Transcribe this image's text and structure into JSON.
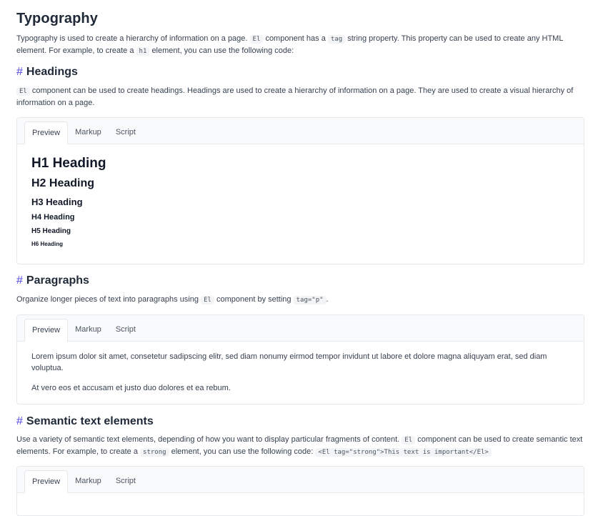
{
  "title": "Typography",
  "intro": {
    "t1": "Typography is used to create a hierarchy of information on a page.",
    "c1": "El",
    "t2": "component has a",
    "c2": "tag",
    "t3": "string property. This property can be used to create any HTML element. For example, to create a",
    "c3": "h1",
    "t4": "element, you can use the following code:"
  },
  "headings": {
    "hash": "#",
    "title": "Headings",
    "c1": "El",
    "text": "component can be used to create headings. Headings are used to create a hierarchy of information on a page. They are used to create a visual hierarchy of information on a page.",
    "tabs": [
      "Preview",
      "Markup",
      "Script"
    ],
    "preview": [
      "H1 Heading",
      "H2 Heading",
      "H3 Heading",
      "H4 Heading",
      "H5 Heading",
      "H6 Heading"
    ]
  },
  "paragraphs": {
    "hash": "#",
    "title": "Paragraphs",
    "t1": "Organize longer pieces of text into paragraphs using",
    "c1": "El",
    "t2": "component by setting",
    "c2": "tag=\"p\"",
    "t3": ".",
    "tabs": [
      "Preview",
      "Markup",
      "Script"
    ],
    "preview": [
      "Lorem ipsum dolor sit amet, consetetur sadipscing elitr, sed diam nonumy eirmod tempor invidunt ut labore et dolore magna aliquyam erat, sed diam voluptua.",
      "At vero eos et accusam et justo duo dolores et ea rebum."
    ]
  },
  "semantic": {
    "hash": "#",
    "title": "Semantic text elements",
    "t1": "Use a variety of semantic text elements, depending of how you want to display particular fragments of content.",
    "c1": "El",
    "t2": "component can be used to create semantic text elements. For example, to create a",
    "c2": "strong",
    "t3": "element, you can use the following code:",
    "c3": "<El tag=\"strong\">This text is important</El>",
    "tabs": [
      "Preview",
      "Markup",
      "Script"
    ]
  }
}
